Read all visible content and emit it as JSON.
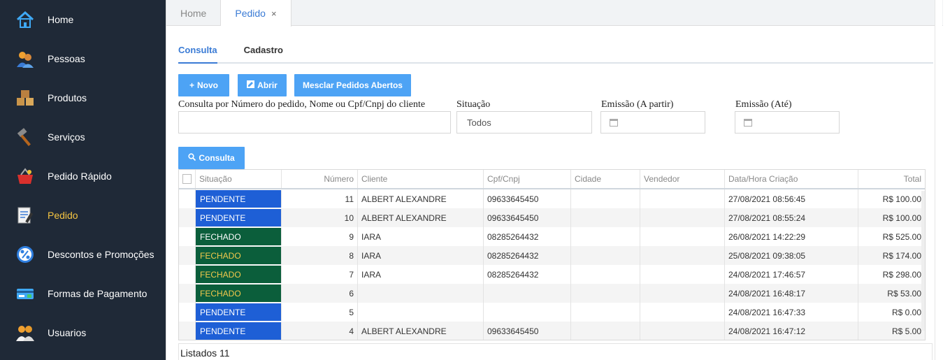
{
  "sidebar": {
    "items": [
      {
        "label": "Home",
        "icon": "home-icon"
      },
      {
        "label": "Pessoas",
        "icon": "people-icon"
      },
      {
        "label": "Produtos",
        "icon": "boxes-icon"
      },
      {
        "label": "Serviços",
        "icon": "hammer-icon"
      },
      {
        "label": "Pedido Rápido",
        "icon": "basket-icon"
      },
      {
        "label": "Pedido",
        "icon": "order-document-icon"
      },
      {
        "label": "Descontos e Promoções",
        "icon": "percent-icon"
      },
      {
        "label": "Formas de Pagamento",
        "icon": "credit-card-icon"
      },
      {
        "label": "Usuarios",
        "icon": "users-icon"
      }
    ],
    "active": "Pedido"
  },
  "top_tabs": [
    {
      "label": "Home"
    },
    {
      "label": "Pedido",
      "close": "×"
    }
  ],
  "sub_tabs": [
    {
      "label": "Consulta"
    },
    {
      "label": "Cadastro"
    }
  ],
  "toolbar": {
    "novo_icon": "+",
    "novo_label": "Novo",
    "abrir_label": "Abrir",
    "mesclar_label": "Mesclar Pedidos Abertos"
  },
  "filters": {
    "consulta_label": "Consulta por Número do pedido, Nome ou Cpf/Cnpj do cliente",
    "consulta_value": "",
    "situacao_label": "Situação",
    "situacao_value": "Todos",
    "emissao_de_label": "Emissão (A partir)",
    "emissao_ate_label": "Emissão (Até)"
  },
  "consulta_button": {
    "label": "Consulta"
  },
  "grid": {
    "columns": [
      "Situação",
      "Número",
      "Cliente",
      "Cpf/Cnpj",
      "Cidade",
      "Vendedor",
      "Data/Hora Criação",
      "Total"
    ],
    "rows": [
      {
        "situacao": "PENDENTE",
        "numero": "11",
        "cliente": "ALBERT ALEXANDRE",
        "cpf": "09633645450",
        "cidade": "",
        "vendedor": "",
        "data": "27/08/2021 08:56:45",
        "total": "R$ 100.00"
      },
      {
        "situacao": "PENDENTE",
        "numero": "10",
        "cliente": "ALBERT ALEXANDRE",
        "cpf": "09633645450",
        "cidade": "",
        "vendedor": "",
        "data": "27/08/2021 08:55:24",
        "total": "R$ 100.00"
      },
      {
        "situacao": "FECHADO",
        "numero": "9",
        "cliente": "IARA",
        "cpf": "08285264432",
        "cidade": "",
        "vendedor": "",
        "data": "26/08/2021 14:22:29",
        "total": "R$ 525.00"
      },
      {
        "situacao": "FECHADO",
        "numero": "8",
        "cliente": "IARA",
        "cpf": "08285264432",
        "cidade": "",
        "vendedor": "",
        "data": "25/08/2021 09:38:05",
        "total": "R$ 174.00"
      },
      {
        "situacao": "FECHADO",
        "numero": "7",
        "cliente": "IARA",
        "cpf": "08285264432",
        "cidade": "",
        "vendedor": "",
        "data": "24/08/2021 17:46:57",
        "total": "R$ 298.00"
      },
      {
        "situacao": "FECHADO",
        "numero": "6",
        "cliente": "",
        "cpf": "",
        "cidade": "",
        "vendedor": "",
        "data": "24/08/2021 16:48:17",
        "total": "R$ 53.00"
      },
      {
        "situacao": "PENDENTE",
        "numero": "5",
        "cliente": "",
        "cpf": "",
        "cidade": "",
        "vendedor": "",
        "data": "24/08/2021 16:47:33",
        "total": "R$ 0.00"
      },
      {
        "situacao": "PENDENTE",
        "numero": "4",
        "cliente": "ALBERT ALEXANDRE",
        "cpf": "09633645450",
        "cidade": "",
        "vendedor": "",
        "data": "24/08/2021 16:47:12",
        "total": "R$ 5.00"
      }
    ]
  },
  "footer": {
    "listed": "Listados 11"
  },
  "colors": {
    "sidebar_bg": "#1f2937",
    "sidebar_active": "#f5c542",
    "accent": "#4da3f5",
    "pendente": "#1e5fd6",
    "fechado": "#0b5e3b"
  }
}
